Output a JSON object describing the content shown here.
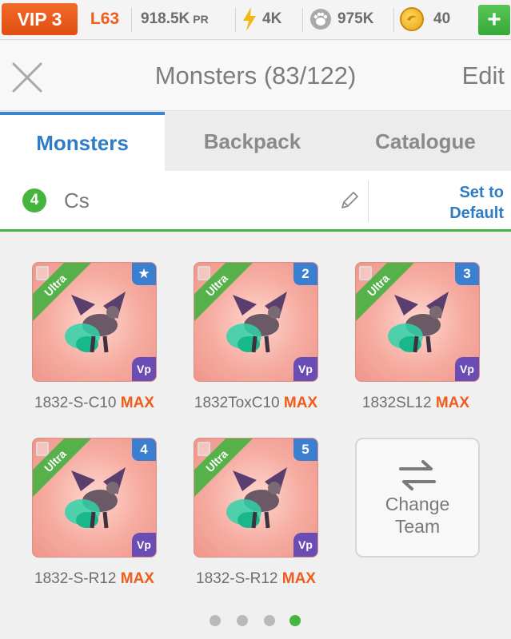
{
  "topbar": {
    "vip": "VIP 3",
    "level": "L63",
    "power": "918.5K",
    "power_unit": "PR",
    "energy": "4K",
    "food": "975K",
    "gold": "40",
    "add_button": "+"
  },
  "header": {
    "title": "Monsters (83/122)",
    "edit_label": "Edit"
  },
  "tabs": [
    {
      "label": "Monsters",
      "active": true
    },
    {
      "label": "Backpack",
      "active": false
    },
    {
      "label": "Catalogue",
      "active": false
    }
  ],
  "team": {
    "number": "4",
    "name": "Cs",
    "default_line1": "Set to",
    "default_line2": "Default"
  },
  "monsters": [
    {
      "rarity": "Ultra",
      "slot": "★",
      "badge": "Vp",
      "name": "1832-S-C10",
      "status": "MAX"
    },
    {
      "rarity": "Ultra",
      "slot": "2",
      "badge": "Vp",
      "name": "1832ToxC10",
      "status": "MAX"
    },
    {
      "rarity": "Ultra",
      "slot": "3",
      "badge": "Vp",
      "name": "1832SL12",
      "status": "MAX"
    },
    {
      "rarity": "Ultra",
      "slot": "4",
      "badge": "Vp",
      "name": "1832-S-R12",
      "status": "MAX"
    },
    {
      "rarity": "Ultra",
      "slot": "5",
      "badge": "Vp",
      "name": "1832-S-R12",
      "status": "MAX"
    }
  ],
  "change_team": {
    "line1": "Change",
    "line2": "Team"
  },
  "pager": {
    "pages": 4,
    "active_page": 4
  },
  "colors": {
    "accent_blue": "#2f7cc4",
    "accent_green": "#45b53f",
    "accent_orange": "#ef5c1c",
    "card_bg": "#f6aca1"
  }
}
